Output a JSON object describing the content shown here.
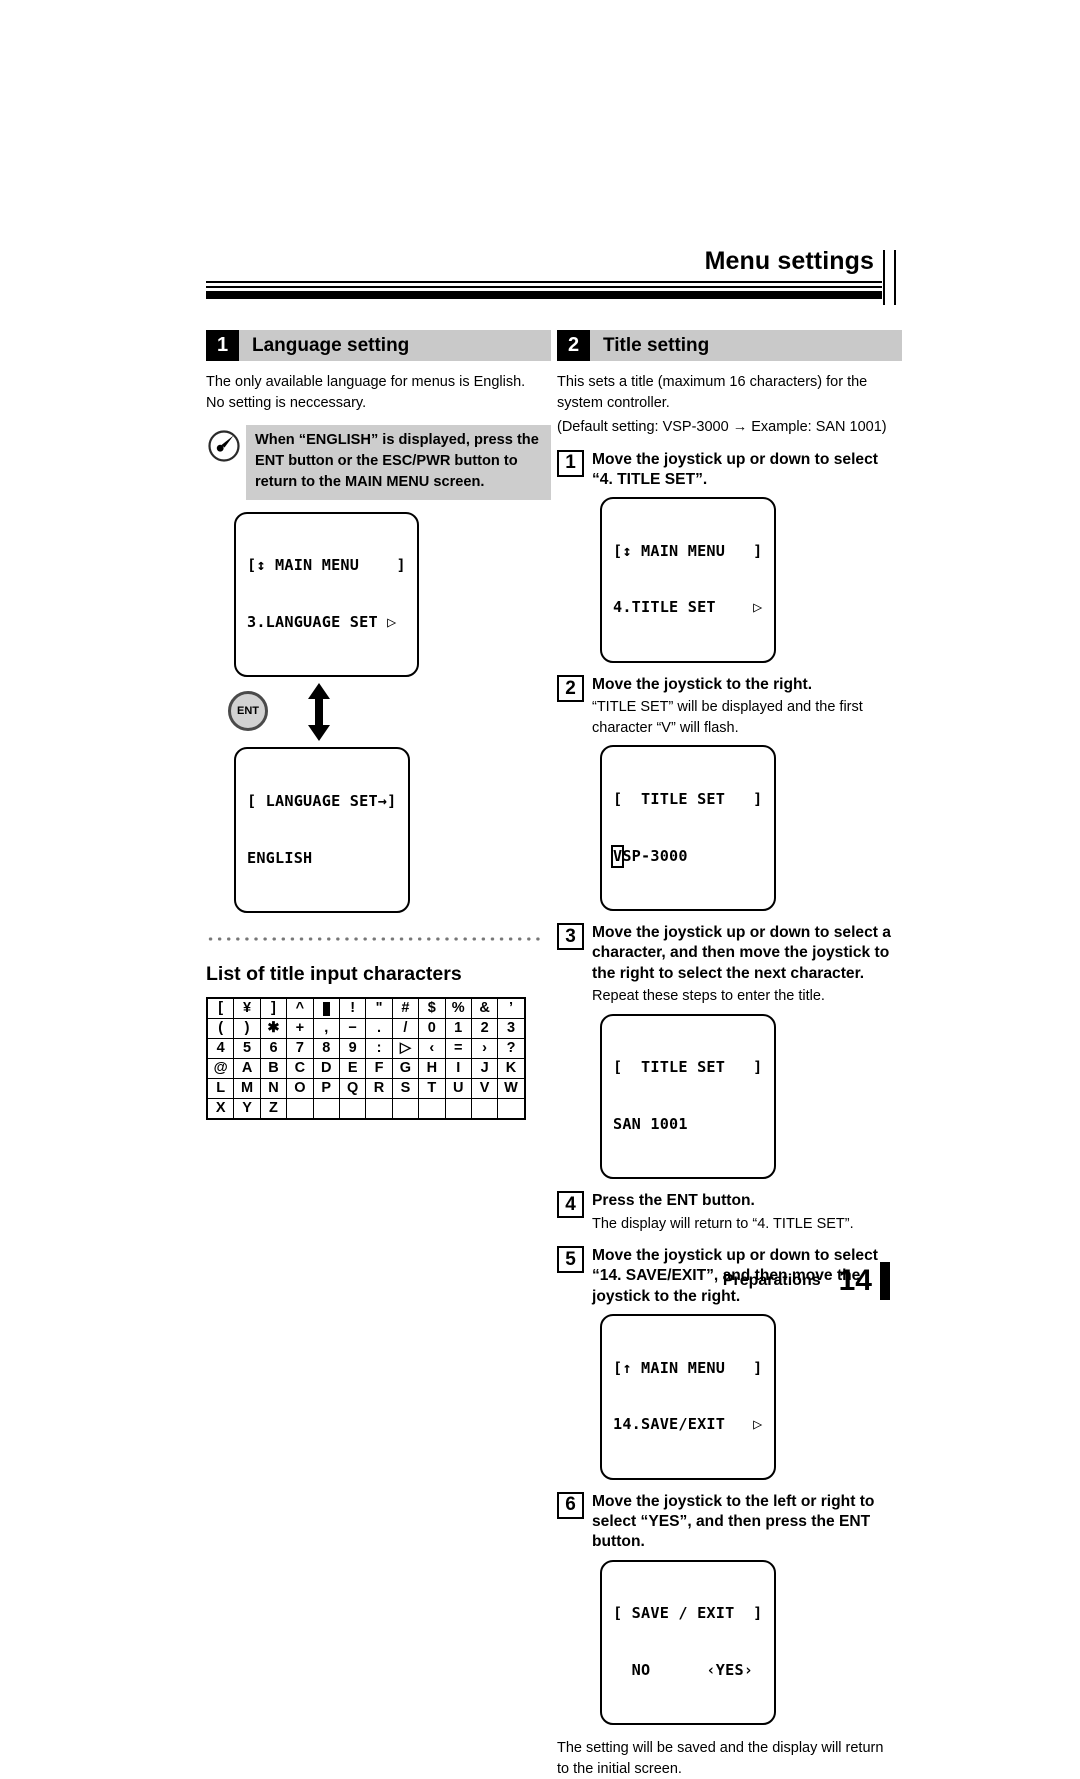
{
  "header": {
    "title": "Menu settings"
  },
  "sections": {
    "language": {
      "number": "1",
      "title": "Language setting",
      "intro": "The only available language for menus is English. No setting is neccessary.",
      "note_icon": "pencil-note-icon",
      "note": "When “ENGLISH” is displayed, press the ENT button or the ESC/PWR button to return to the MAIN MENU screen.",
      "lcd_main_menu": {
        "line1": "[↕ MAIN MENU    ]",
        "line2": "3.LANGUAGE SET ▷"
      },
      "ent_button_label": "ENT",
      "arrow_icon": "up-down-arrow-icon",
      "lcd_language_set": {
        "line1": "[ LANGUAGE SET→]",
        "line2": "ENGLISH"
      }
    },
    "charlist": {
      "heading": "List of title input characters",
      "rows": [
        [
          "[",
          "¥",
          "]",
          "^",
          "█",
          "!",
          "\"",
          "#",
          "$",
          "%",
          "&",
          "’"
        ],
        [
          "(",
          ")",
          "✱",
          "+",
          ",",
          "−",
          ".",
          "/",
          "0",
          "1",
          "2",
          "3"
        ],
        [
          "4",
          "5",
          "6",
          "7",
          "8",
          "9",
          ":",
          "▷",
          "‹",
          "=",
          "›",
          "?"
        ],
        [
          "@",
          "A",
          "B",
          "C",
          "D",
          "E",
          "F",
          "G",
          "H",
          "I",
          "J",
          "K"
        ],
        [
          "L",
          "M",
          "N",
          "O",
          "P",
          "Q",
          "R",
          "S",
          "T",
          "U",
          "V",
          "W"
        ],
        [
          "X",
          "Y",
          "Z",
          "",
          "",
          "",
          "",
          "",
          "",
          "",
          "",
          ""
        ]
      ]
    },
    "title": {
      "number": "2",
      "title": "Title setting",
      "intro_line1": "This sets a title (maximum 16 characters) for the system controller.",
      "intro_line2": "(Default setting: VSP-3000 → Example: SAN 1001)",
      "steps": [
        {
          "num": "1",
          "title": "Move the joystick up or down to select “4. TITLE SET”.",
          "sub": "",
          "lcd": {
            "line1": "[↕ MAIN MENU   ]",
            "line2": "4.TITLE SET    ▷"
          }
        },
        {
          "num": "2",
          "title": "Move the joystick to the right.",
          "sub_plain_prefix": "",
          "sub_bold1": "TITLE SET",
          "sub": "“TITLE SET” will be displayed and the first character “V” will flash.",
          "lcd": {
            "line1": "[  TITLE SET   ]",
            "line2_cursor": "V",
            "line2_rest": "SP-3000"
          }
        },
        {
          "num": "3",
          "title": "Move the joystick up or down to select a character, and then move the joystick to the right to select the next character.",
          "sub": "Repeat these steps to enter the title.",
          "lcd": {
            "line1": "[  TITLE SET   ]",
            "line2": "SAN 1001"
          }
        },
        {
          "num": "4",
          "title": "Press the ENT button.",
          "sub": "The display will return to “4. TITLE SET”.",
          "lcd": null
        },
        {
          "num": "5",
          "title": "Move the joystick up or down to select “14. SAVE/EXIT”, and then move the joystick to the right.",
          "sub": "",
          "lcd": {
            "line1": "[↑ MAIN MENU   ]",
            "line2": "14.SAVE/EXIT   ▷"
          }
        },
        {
          "num": "6",
          "title": "Move the joystick to the left or right to select “YES”, and then press the ENT button.",
          "sub": "",
          "lcd": {
            "line1": "[ SAVE / EXIT  ]",
            "line2": "  NO      ‹YES›"
          }
        }
      ],
      "closing": "The setting will be saved and the display will return to the initial screen."
    }
  },
  "footer": {
    "label": "Preparations",
    "page": "14"
  },
  "colors": {
    "section_bar": "#c9c9c9",
    "note_bg": "#cdcdcd",
    "ink": "#000000",
    "dots": "#767676"
  }
}
